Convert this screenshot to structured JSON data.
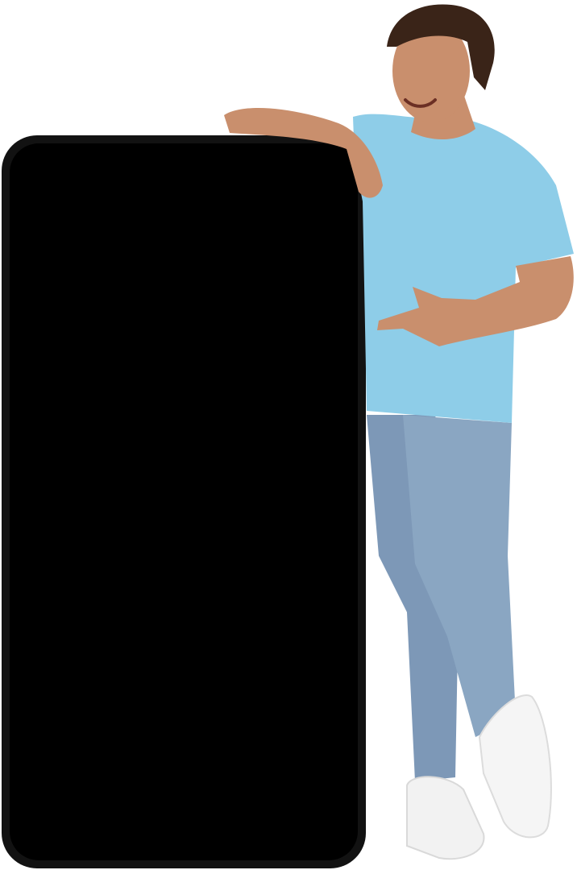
{
  "scene": {
    "background_color": "#ffffff",
    "phone": {
      "frame_color": "#121212",
      "screen_color": "#000000"
    },
    "person": {
      "skin_color": "#c98f6d",
      "hair_color": "#3a2418",
      "shirt_color": "#8ecde8",
      "jeans_color": "#7d98b7",
      "shoe_color": "#f2f2f2"
    }
  }
}
